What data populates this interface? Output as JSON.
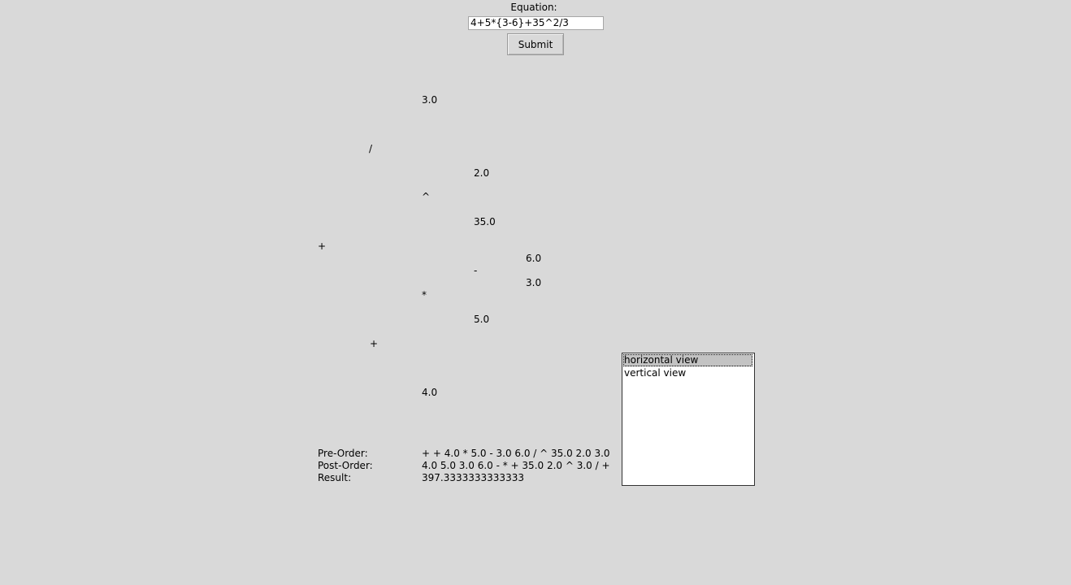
{
  "equation": {
    "label": "Equation:",
    "value": "4+5*{3-6}+35^2/3"
  },
  "submit_label": "Submit",
  "tree": {
    "nodes": [
      "3.0",
      "/",
      "2.0",
      "^",
      "35.0",
      "+",
      "6.0",
      "-",
      "3.0",
      "*",
      "5.0",
      "+",
      "4.0"
    ]
  },
  "results": {
    "preorder_label": "Pre-Order:",
    "preorder_value": "+ + 4.0 * 5.0 - 3.0 6.0 / ^ 35.0 2.0 3.0",
    "postorder_label": "Post-Order:",
    "postorder_value": "4.0 5.0 3.0 6.0 - * + 35.0 2.0 ^ 3.0 / +",
    "result_label": "Result:",
    "result_value": "397.3333333333333"
  },
  "view_list": {
    "items": [
      "horizontal view",
      "vertical view"
    ],
    "selected": "horizontal view"
  }
}
